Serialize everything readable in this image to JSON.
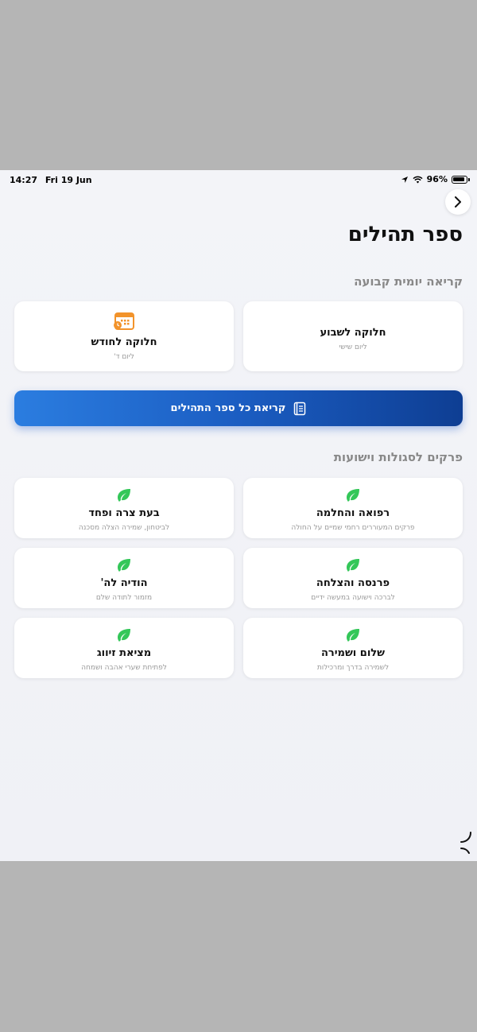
{
  "status": {
    "time": "14:27",
    "date": "Fri 19 Jun",
    "battery": "96%"
  },
  "page_title": "ספר תהילים",
  "daily_section": {
    "title": "קריאה יומית קבועה",
    "weekly": {
      "title": "חלוקה לשבוע",
      "sub": "ליום שישי"
    },
    "monthly": {
      "title": "חלוקה לחודש",
      "sub": "ליום ד'"
    }
  },
  "read_all_label": "קריאת כל ספר התהילים",
  "segulot_section": {
    "title": "פרקים לסגולות וישועות",
    "items": [
      {
        "title": "רפואה והחלמה",
        "sub": "פרקים המעוררים רחמי שמיים על החולה"
      },
      {
        "title": "בעת צרה ופחד",
        "sub": "לביטחון, שמירה הצלה מסכנה"
      },
      {
        "title": "פרנסה והצלחה",
        "sub": "לברכה וישועה במעשה ידיים"
      },
      {
        "title": "הודיה לה'",
        "sub": "מזמור לתודה שלם"
      },
      {
        "title": "שלום ושמירה",
        "sub": "לשמירה בדרך ומרכילות"
      },
      {
        "title": "מציאת זיווג",
        "sub": "לפתיחת שערי אהבה ושמחה"
      }
    ]
  },
  "colors": {
    "accent_blue": "#1b5dc2",
    "leaf_green": "#34c759",
    "calendar_orange": "#f2932b"
  },
  "icons": {
    "back": "chevron-right-icon",
    "book": "book-icon",
    "leaf": "leaf-icon",
    "calendar": "calendar-icon"
  }
}
